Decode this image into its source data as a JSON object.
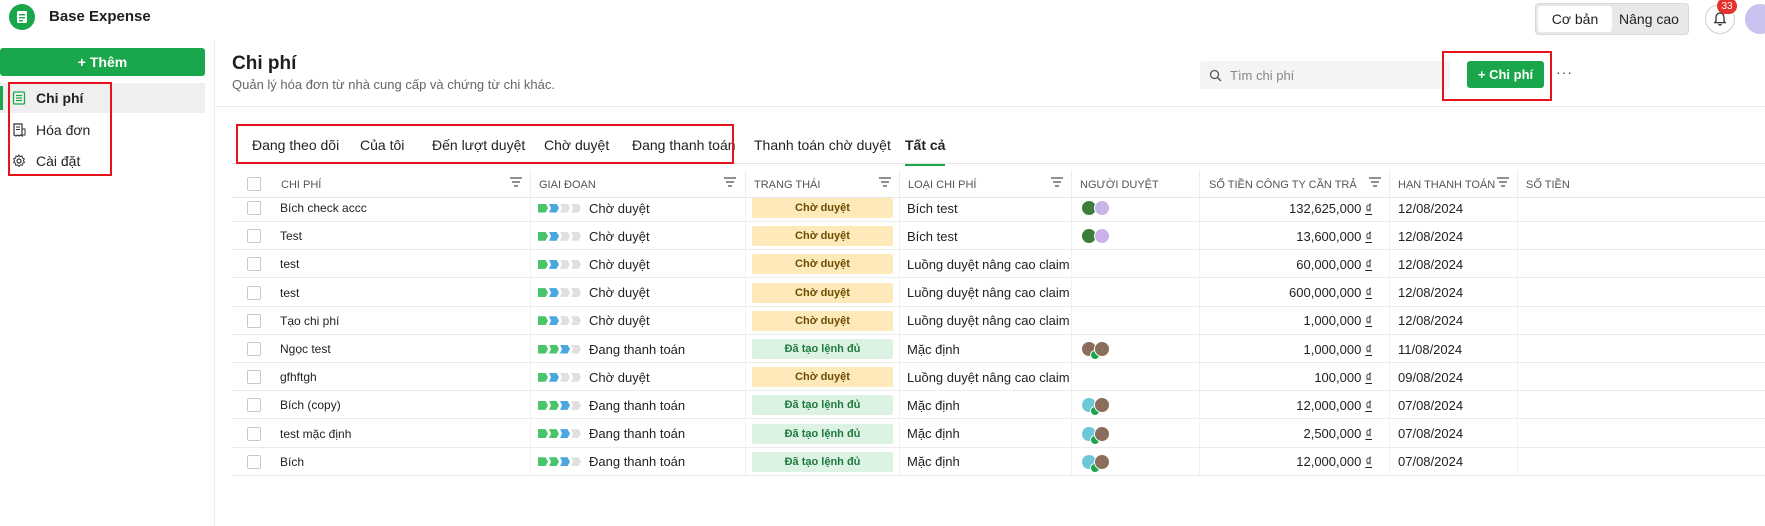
{
  "app": {
    "name": "Base Expense"
  },
  "topbar": {
    "mode_basic": "Cơ bản",
    "mode_advanced": "Nâng cao",
    "notification_count": "33"
  },
  "sidebar": {
    "add_label": "+ Thêm",
    "items": [
      {
        "label": "Chi phí",
        "icon": "document-list-icon",
        "active": true
      },
      {
        "label": "Hóa đơn",
        "icon": "invoice-icon",
        "active": false
      },
      {
        "label": "Cài đặt",
        "icon": "gear-icon",
        "active": false
      }
    ]
  },
  "page": {
    "title": "Chi phí",
    "subtitle": "Quản lý hóa đơn từ nhà cung cấp và chứng từ chi khác.",
    "search_placeholder": "Tìm chi phí",
    "new_button": "+ Chi phí",
    "more": "···"
  },
  "tabs": [
    {
      "label": "Đang theo dõi",
      "active": false
    },
    {
      "label": "Của tôi",
      "active": false
    },
    {
      "label": "Đến lượt duyệt",
      "active": false
    },
    {
      "label": "Chờ duyệt",
      "active": false
    },
    {
      "label": "Đang thanh toán",
      "active": false
    },
    {
      "label": "Thanh toán chờ duyệt",
      "active": false
    },
    {
      "label": "Tất cả",
      "active": true
    }
  ],
  "columns": {
    "expense": "CHI PHÍ",
    "stage": "GIAI ĐOẠN",
    "status": "TRẠNG THÁI",
    "type": "LOẠI CHI PHÍ",
    "approver": "NGƯỜI DUYỆT",
    "company_amount": "SỐ TIỀN CÔNG TY CẦN TRẢ",
    "due_date": "HẠN THANH TOÁN",
    "amount_partial": "SỐ TIỀN"
  },
  "currency": "₫",
  "rows": [
    {
      "name": "Bích check accc",
      "stage": "Chờ duyệt",
      "stage_done": 1,
      "stage_current": 2,
      "status": "Chờ duyệt",
      "status_kind": "wait",
      "type": "Bích test",
      "approvers": [
        "leaf",
        "lavender"
      ],
      "amount": "132,625,000",
      "due": "12/08/2024"
    },
    {
      "name": "Test",
      "stage": "Chờ duyệt",
      "stage_done": 1,
      "stage_current": 2,
      "status": "Chờ duyệt",
      "status_kind": "wait",
      "type": "Bích test",
      "approvers": [
        "leaf",
        "lavender"
      ],
      "amount": "13,600,000",
      "due": "12/08/2024"
    },
    {
      "name": "test",
      "stage": "Chờ duyệt",
      "stage_done": 1,
      "stage_current": 2,
      "status": "Chờ duyệt",
      "status_kind": "wait",
      "type": "Luồng duyệt nâng cao claim",
      "approvers": [],
      "amount": "60,000,000",
      "due": "12/08/2024"
    },
    {
      "name": "test",
      "stage": "Chờ duyệt",
      "stage_done": 1,
      "stage_current": 2,
      "status": "Chờ duyệt",
      "status_kind": "wait",
      "type": "Luồng duyệt nâng cao claim",
      "approvers": [],
      "amount": "600,000,000",
      "due": "12/08/2024"
    },
    {
      "name": "Tạo chi phí",
      "stage": "Chờ duyệt",
      "stage_done": 1,
      "stage_current": 2,
      "status": "Chờ duyệt",
      "status_kind": "wait",
      "type": "Luồng duyệt nâng cao claim",
      "approvers": [],
      "amount": "1,000,000",
      "due": "12/08/2024"
    },
    {
      "name": "Ngọc test",
      "stage": "Đang thanh toán",
      "stage_done": 2,
      "stage_current": 3,
      "status": "Đã tạo lệnh đủ",
      "status_kind": "pay",
      "type": "Mặc định",
      "approvers": [
        "person-check",
        "person"
      ],
      "amount": "1,000,000",
      "due": "11/08/2024"
    },
    {
      "name": "gfhftgh",
      "stage": "Chờ duyệt",
      "stage_done": 1,
      "stage_current": 2,
      "status": "Chờ duyệt",
      "status_kind": "wait",
      "type": "Luồng duyệt nâng cao claim",
      "approvers": [],
      "amount": "100,000",
      "due": "09/08/2024"
    },
    {
      "name": "Bích (copy)",
      "stage": "Đang thanh toán",
      "stage_done": 2,
      "stage_current": 3,
      "status": "Đã tạo lệnh đủ",
      "status_kind": "pay",
      "type": "Mặc định",
      "approvers": [
        "teal-check",
        "person"
      ],
      "amount": "12,000,000",
      "due": "07/08/2024"
    },
    {
      "name": "test mặc định",
      "stage": "Đang thanh toán",
      "stage_done": 2,
      "stage_current": 3,
      "status": "Đã tạo lệnh đủ",
      "status_kind": "pay",
      "type": "Mặc định",
      "approvers": [
        "teal-check",
        "person"
      ],
      "amount": "2,500,000",
      "due": "07/08/2024"
    },
    {
      "name": "Bích",
      "stage": "Đang thanh toán",
      "stage_done": 2,
      "stage_current": 3,
      "status": "Đã tạo lệnh đủ",
      "status_kind": "pay",
      "type": "Mặc định",
      "approvers": [
        "teal-check",
        "person"
      ],
      "amount": "12,000,000",
      "due": "07/08/2024"
    }
  ],
  "colors": {
    "brand_green": "#1aa64a",
    "annotation_red": "#e8121b",
    "wait_bg": "#fde9b9",
    "pay_bg": "#dcf2e3"
  }
}
